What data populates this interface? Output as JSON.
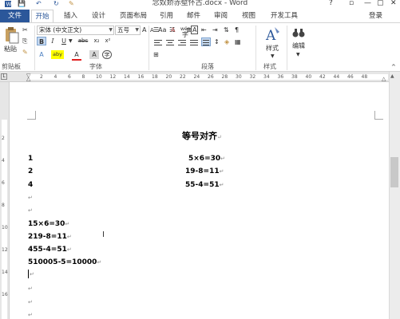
{
  "window": {
    "title": "念奴娇赤壁怀古.docx - Word",
    "help": "?",
    "minimize": "—",
    "restore": "▢",
    "close": "✕"
  },
  "qat": {
    "save": "💾",
    "undo": "↶",
    "redo": "↻",
    "brush": "✎"
  },
  "tabs": {
    "file": "文件",
    "home": "开始",
    "insert": "插入",
    "design": "设计",
    "layout": "页面布局",
    "references": "引用",
    "mailings": "邮件",
    "review": "审阅",
    "view": "视图",
    "developer": "开发工具",
    "login": "登录"
  },
  "ribbon": {
    "clipboard": {
      "paste": "粘贴",
      "label": "剪贴板"
    },
    "font": {
      "family": "宋体 (中文正文)",
      "size": "五号",
      "label": "字体",
      "bold": "B",
      "italic": "I",
      "underline": "U",
      "strike": "abc",
      "subscript": "x₂",
      "superscript": "x²",
      "grow": "A",
      "shrink": "A",
      "case": "Aa",
      "clear": "A",
      "wen": "wén",
      "border_a": "A",
      "highlight": "aby",
      "color_a": "A",
      "char_shade": "A",
      "enclose": "字"
    },
    "paragraph": {
      "label": "段落"
    },
    "styles": {
      "name": "样式",
      "label": "样式"
    },
    "editing": {
      "name": "编辑"
    }
  },
  "ruler": {
    "ticks": [
      "2",
      "4",
      "6",
      "8",
      "10",
      "12",
      "14",
      "16",
      "18",
      "20",
      "22",
      "24",
      "26",
      "28",
      "30",
      "32",
      "34",
      "36",
      "38",
      "40",
      "42",
      "44",
      "46",
      "48"
    ],
    "vticks": [
      "2",
      "4",
      "6",
      "8",
      "10",
      "12",
      "14",
      "16"
    ]
  },
  "document": {
    "title": "等号对齐",
    "pilcrow": "↵",
    "rows": [
      {
        "left": "1",
        "right": "5×6=30"
      },
      {
        "left": "2",
        "right": "19-8=11"
      },
      {
        "left": "4",
        "right": "55-4=51"
      }
    ],
    "lines": [
      "15×6=30",
      "219-8=11",
      "455-4=51",
      "510005-5=10000"
    ],
    "colors": {
      "accent": "#2b579a",
      "ribbon_bg": "#ffffff",
      "workspace": "#e6e6e6"
    }
  }
}
